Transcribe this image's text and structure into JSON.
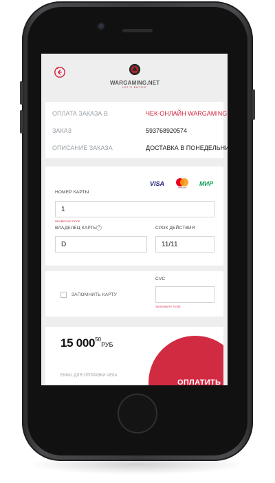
{
  "colors": {
    "accent": "#d12b42",
    "screen_bg": "#eeeeee",
    "card_bg": "#ffffff"
  },
  "header": {
    "back_icon": "back-clock-icon",
    "logo": {
      "name": "WARGAMING.NET",
      "tagline": "LET'S BATTLE"
    }
  },
  "order": {
    "rows": [
      {
        "key": "ОПЛАТА ЗАКАЗА В",
        "value": "ЧЕК-ОНЛАЙН WARGAMING.NET"
      },
      {
        "key": "ЗАКАЗ",
        "value": "593768920574"
      },
      {
        "key": "ОПИСАНИЕ ЗАКАЗА",
        "value": "ДОСТАВКА В ПОНЕДЕЛЬНИК"
      }
    ]
  },
  "payment": {
    "brands": [
      "VISA",
      "mastercard",
      "МИР"
    ],
    "card_number_label": "НОМЕР КАРТЫ",
    "card_number_value": "1",
    "card_number_hint": "ПРОВЕРЬТЕ ПОЛЕ",
    "holder_label": "ВЛАДЕЛЕЦ КАРТЫ",
    "holder_help": "?",
    "holder_value": "D",
    "expiry_label": "СРОК ДЕЙСТВИЯ",
    "expiry_value": "11/11"
  },
  "save": {
    "remember_label": "ЗАПОМНИТЬ КАРТУ",
    "cvc_label": "CVC",
    "cvc_value": "",
    "cvc_hint": "ЗАПОЛНИТЕ ПОЛЕ"
  },
  "total": {
    "amount": "15 000",
    "kopecks": "50",
    "currency": "РУБ",
    "email_label": "EMAIL ДЛЯ ОТПРАВКИ ЧЕКА",
    "pay_label": "ОПЛАТИТЬ"
  }
}
